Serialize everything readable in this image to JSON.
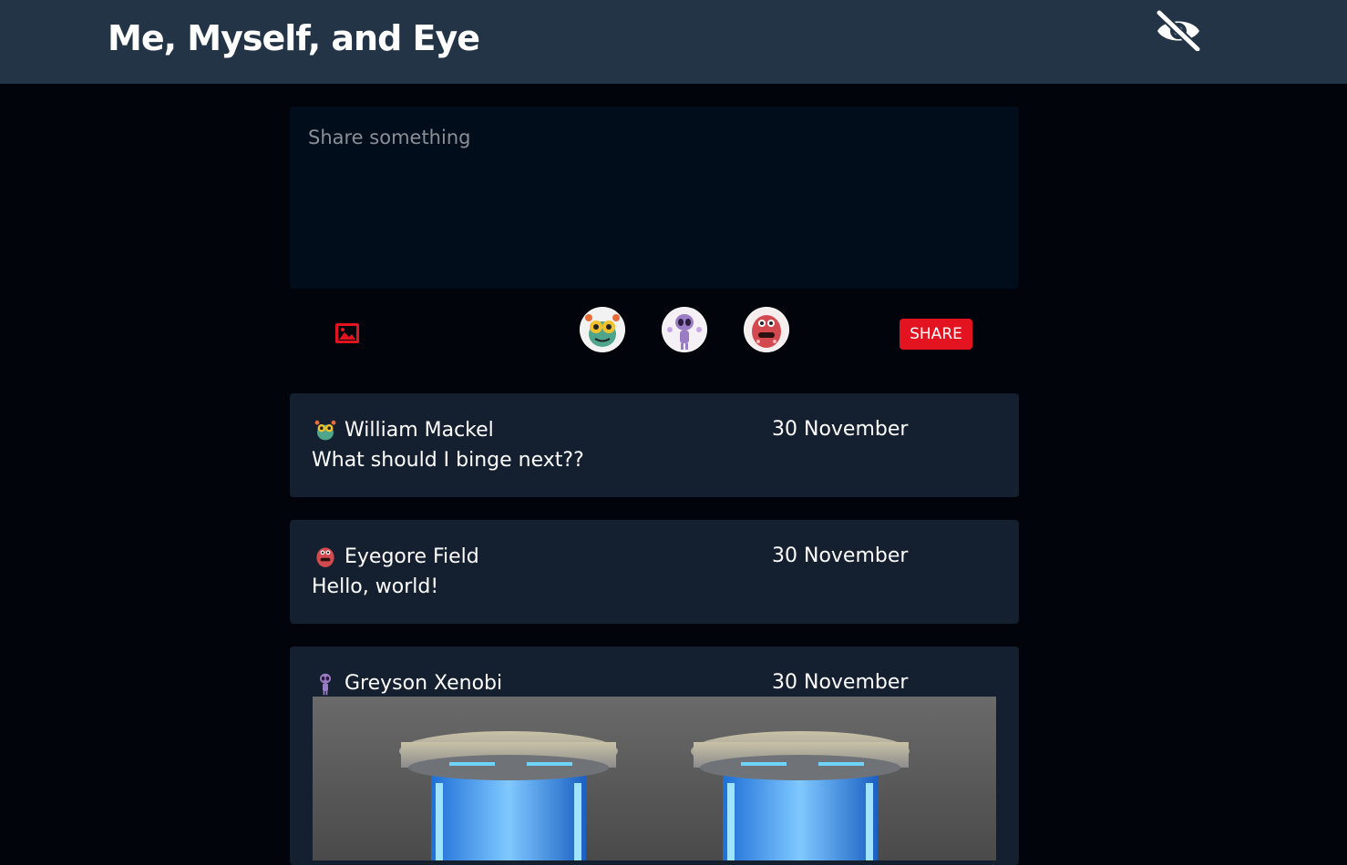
{
  "header": {
    "title": "Me, Myself, and Eye",
    "toggle_icon": "eye-slash-icon"
  },
  "composer": {
    "placeholder": "Share something",
    "image_icon": "image-icon",
    "avatars": [
      "green-monster-avatar",
      "purple-alien-avatar",
      "red-blob-avatar"
    ],
    "share_label": "SHARE",
    "accent": "#e3141f"
  },
  "posts": [
    {
      "author": "William Mackel",
      "date": "30 November",
      "text": "What should I binge next??",
      "avatar": "green-monster-avatar"
    },
    {
      "author": "Eyegore Field",
      "date": "30 November",
      "text": "Hello, world!",
      "avatar": "red-blob-avatar"
    },
    {
      "author": "Greyson Xenobi",
      "date": "30 November",
      "text": "",
      "avatar": "purple-alien-avatar",
      "image": "cryo-pods-image"
    }
  ]
}
